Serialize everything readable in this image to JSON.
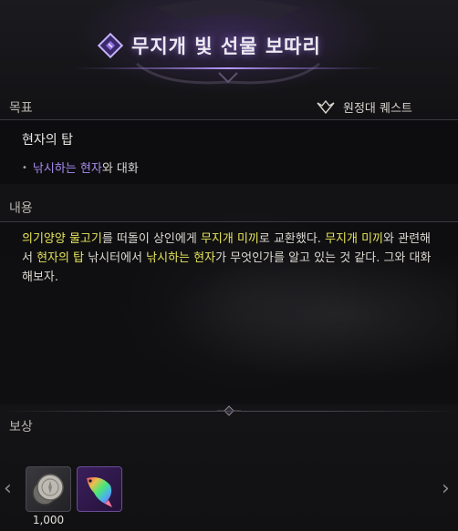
{
  "header": {
    "title": "무지개 빛 선물 보따리"
  },
  "objective": {
    "section_label": "목표",
    "quest_type": "원정대 퀘스트",
    "title": "현자의 탑",
    "item": {
      "npc": "낚시하는 현자",
      "suffix": "와 대화"
    }
  },
  "content": {
    "section_label": "내용",
    "segments": [
      {
        "text": "의기양양 물고기",
        "style": "g"
      },
      {
        "text": "를 떠돌이 상인에게 ",
        "style": ""
      },
      {
        "text": "무지개 미끼",
        "style": "g"
      },
      {
        "text": "로 교환했다. ",
        "style": ""
      },
      {
        "text": "무지개 미끼",
        "style": "g"
      },
      {
        "text": "와 관련해서 ",
        "style": ""
      },
      {
        "text": "현자의 탑",
        "style": "g"
      },
      {
        "text": " 낚시터에서 ",
        "style": ""
      },
      {
        "text": "낚시하는 현자",
        "style": "g"
      },
      {
        "text": "가 무엇인가를 알고 있는 것 같다. 그와 대화해보자.",
        "style": ""
      }
    ]
  },
  "rewards": {
    "section_label": "보상",
    "items": [
      {
        "name": "silver-coin",
        "quantity": "1,000"
      },
      {
        "name": "rainbow-fish",
        "quantity": ""
      }
    ],
    "prev_arrow": "‹",
    "next_arrow": "›"
  },
  "colors": {
    "highlight_yellow": "#e6e45a",
    "highlight_purple": "#a98cf0",
    "title_glow": "#aa82ff"
  }
}
